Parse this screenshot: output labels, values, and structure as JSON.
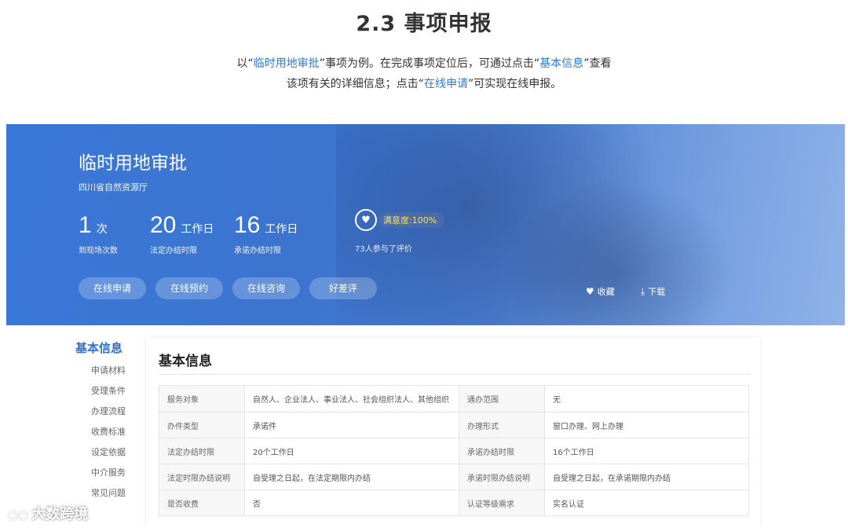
{
  "page": {
    "title": "2.3 事项申报",
    "intro_line1_a": "以“",
    "intro_line1_hl1": "临时用地审批",
    "intro_line1_b": "”事项为例。在完成事项定位后，可通过点击“",
    "intro_line1_hl2": "基本信息",
    "intro_line1_c": "”查看",
    "intro_line2_a": "该项有关的详细信息；点击“",
    "intro_line2_hl": "在线申请",
    "intro_line2_b": "”可实现在线申报。"
  },
  "hero": {
    "title": "临时用地审批",
    "department": "四川省自然资源厅",
    "stats": [
      {
        "num": "1",
        "unit": "次",
        "caption": "到现场次数"
      },
      {
        "num": "20",
        "unit": "工作日",
        "caption": "法定办结时限"
      },
      {
        "num": "16",
        "unit": "工作日",
        "caption": "承诺办结时限"
      }
    ],
    "satisfaction": {
      "badge": "满意度:100%",
      "caption": "73人参与了评价"
    },
    "buttons": [
      "在线申请",
      "在线预约",
      "在线咨询",
      "好差评"
    ],
    "actions": {
      "favorite": "收藏",
      "download": "下载"
    }
  },
  "sidebar": {
    "active": "基本信息",
    "items": [
      "申请材料",
      "受理条件",
      "办理流程",
      "收费标准",
      "设定依据",
      "中介服务",
      "常见问题"
    ]
  },
  "info_card": {
    "title": "基本信息",
    "rows": [
      {
        "k1": "服务对象",
        "v1": "自然人、企业法人、事业法人、社会组织法人、其他组织",
        "k2": "通办范围",
        "v2": "无"
      },
      {
        "k1": "办件类型",
        "v1": "承诺件",
        "k2": "办理形式",
        "v2": "窗口办理、网上办理"
      },
      {
        "k1": "法定办结时限",
        "v1": "20个工作日",
        "k2": "承诺办结时限",
        "v2": "16个工作日"
      },
      {
        "k1": "法定时限办结说明",
        "v1": "自受理之日起，在法定期限内办结",
        "k2": "承诺时限办结说明",
        "v2": "自受理之日起，在承诺期限内办结"
      },
      {
        "k1": "是否收费",
        "v1": "否",
        "k2": "认证等级需求",
        "v2": "实名认证"
      }
    ]
  },
  "watermark": {
    "text": "大数跨境"
  },
  "colors": {
    "accent": "#2f7bd9",
    "hero": "#3c74cf",
    "badge_text": "#f7e25a"
  }
}
